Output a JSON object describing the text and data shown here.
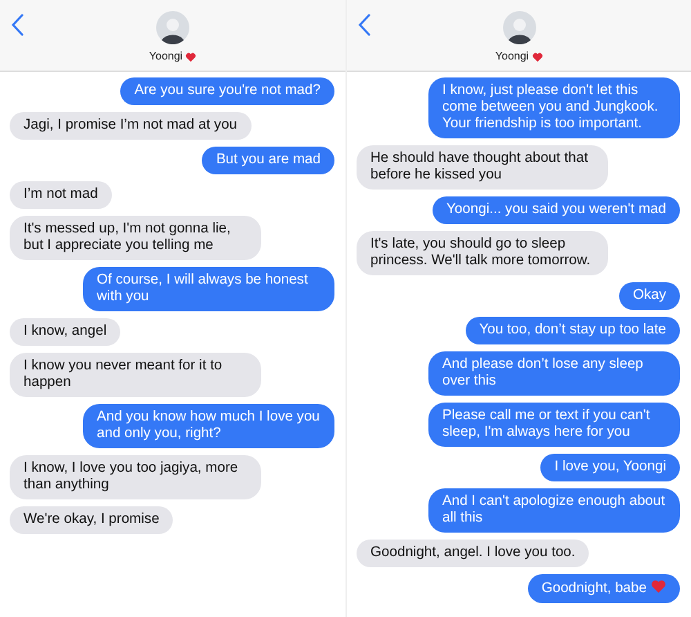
{
  "panels": [
    {
      "header": {
        "contact": "Yoongi",
        "heart": true
      },
      "messages": [
        {
          "kind": "sent",
          "text": "Are you sure you're not mad?"
        },
        {
          "kind": "received",
          "text": "Jagi, I promise I’m not mad at you"
        },
        {
          "kind": "sent",
          "text": "But you are mad"
        },
        {
          "kind": "received",
          "text": "I’m not mad"
        },
        {
          "kind": "received",
          "text": "It's messed up, I'm not gonna lie, but I appreciate you telling me"
        },
        {
          "kind": "sent",
          "text": "Of course, I will always be honest with you"
        },
        {
          "kind": "received",
          "text": "I know, angel"
        },
        {
          "kind": "received",
          "text": "I know you never meant for it to happen"
        },
        {
          "kind": "sent",
          "text": "And you know how much I love you and only you, right?"
        },
        {
          "kind": "received",
          "text": "I know, I love you too jagiya, more than anything"
        },
        {
          "kind": "received",
          "text": "We're okay, I promise"
        }
      ]
    },
    {
      "header": {
        "contact": "Yoongi",
        "heart": true
      },
      "messages": [
        {
          "kind": "sent",
          "text": "I know, just please don't let this come between you and Jungkook. Your friendship is too important."
        },
        {
          "kind": "received",
          "text": "He should have thought about that before he kissed you"
        },
        {
          "kind": "sent",
          "text": "Yoongi... you said you weren't mad"
        },
        {
          "kind": "received",
          "text": "It's late, you should go to sleep princess. We'll talk more tomorrow."
        },
        {
          "kind": "sent",
          "text": "Okay"
        },
        {
          "kind": "sent",
          "text": "You too, don’t stay up too late"
        },
        {
          "kind": "sent",
          "text": "And please don’t lose any sleep over this"
        },
        {
          "kind": "sent",
          "text": "Please call me or text if you can't sleep, I'm always here for you"
        },
        {
          "kind": "sent",
          "text": "I love you, Yoongi"
        },
        {
          "kind": "sent",
          "text": "And I can't apologize enough about all this"
        },
        {
          "kind": "received",
          "text": "Goodnight, angel. I love you too."
        },
        {
          "kind": "sent",
          "text": "Goodnight, babe",
          "heart": true
        }
      ]
    }
  ]
}
